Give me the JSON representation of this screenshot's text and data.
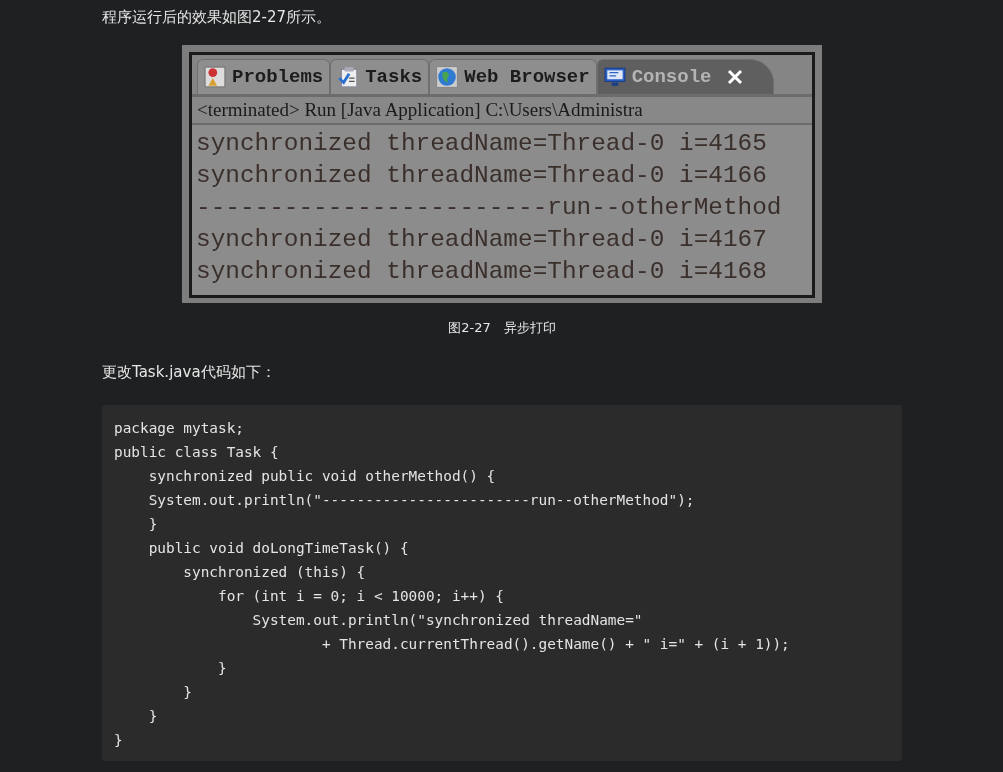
{
  "intro": "程序运行后的效果如图2-27所示。",
  "figure": {
    "tabs": [
      {
        "label": "Problems",
        "kind": "problems",
        "selected": false
      },
      {
        "label": "Tasks",
        "kind": "tasks",
        "selected": false
      },
      {
        "label": "Web Browser",
        "kind": "browser",
        "selected": false
      },
      {
        "label": "Console",
        "kind": "console",
        "selected": true,
        "closable": true
      }
    ],
    "header": "<terminated> Run [Java Application] C:\\Users\\Administra",
    "lines": [
      "synchronized threadName=Thread-0 i=4165",
      "synchronized threadName=Thread-0 i=4166",
      "------------------------run--otherMethod",
      "synchronized threadName=Thread-0 i=4167",
      "synchronized threadName=Thread-0 i=4168"
    ],
    "caption": "图2-27　异步打印"
  },
  "lead": "更改Task.java代码如下：",
  "code": [
    "package mytask;",
    "public class Task {",
    "    synchronized public void otherMethod() {",
    "    System.out.println(\"------------------------run--otherMethod\");",
    "    }",
    "    public void doLongTimeTask() {",
    "        synchronized (this) {",
    "            for (int i = 0; i < 10000; i++) {",
    "                System.out.println(\"synchronized threadName=\"",
    "                        + Thread.currentThread().getName() + \" i=\" + (i + 1));",
    "            }",
    "        }",
    "    }",
    "}"
  ]
}
